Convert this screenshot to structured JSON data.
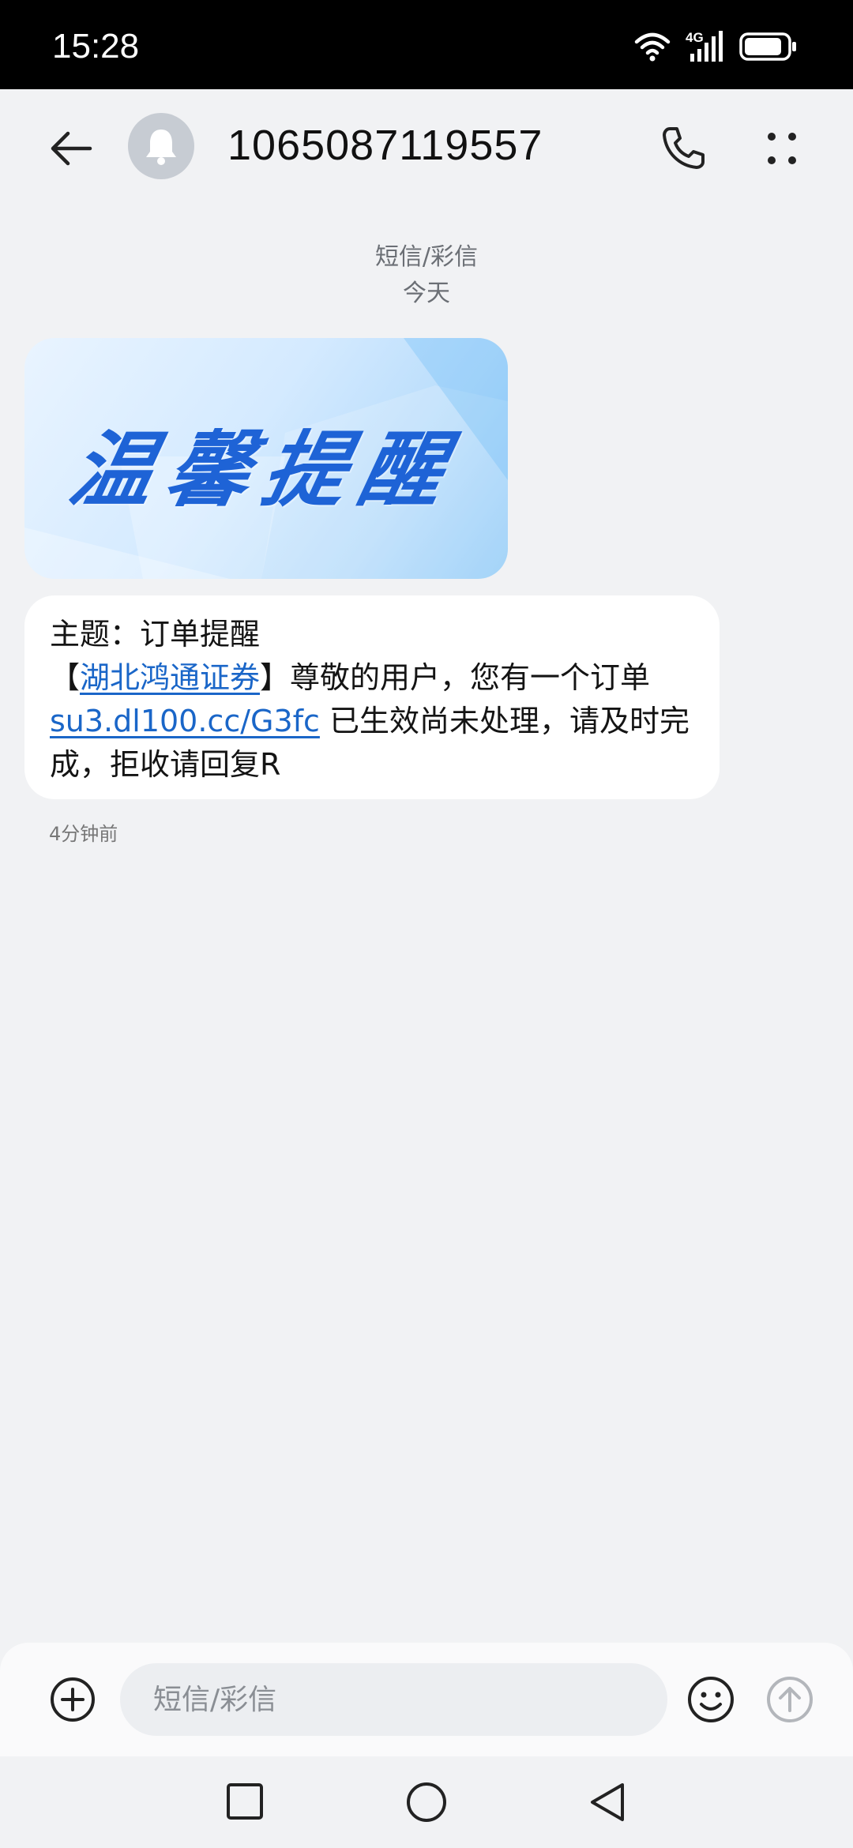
{
  "status_bar": {
    "time": "15:28",
    "icons": [
      "wifi-icon",
      "4g-signal-icon",
      "battery-icon"
    ],
    "network_label": "4G"
  },
  "header": {
    "contact_number": "1065087119557",
    "avatar_icon": "bell-icon",
    "actions": [
      "back-arrow-icon",
      "phone-icon",
      "more-vertical-icon"
    ]
  },
  "conversation": {
    "type_label": "短信/彩信",
    "day_label": "今天"
  },
  "banner": {
    "text": "温馨提醒"
  },
  "message": {
    "line1": "主题：订单提醒",
    "bracket_open": "【",
    "sender_link": "湖北鸿通证券",
    "bracket_close_text": "】尊敬的用户，您有一个订单",
    "url_link": "su3.dl100.cc/G3fc",
    "line3_rest": " 已生效尚未处理，请及时完",
    "line4": "成，拒收请回复R",
    "time_ago": "4分钟前"
  },
  "composer": {
    "placeholder": "短信/彩信",
    "icons": [
      "add-circle-icon",
      "emoji-icon",
      "send-icon"
    ]
  },
  "colors": {
    "link": "#1a66c8",
    "banner_text": "#1e63d6",
    "background": "#f1f2f4"
  }
}
